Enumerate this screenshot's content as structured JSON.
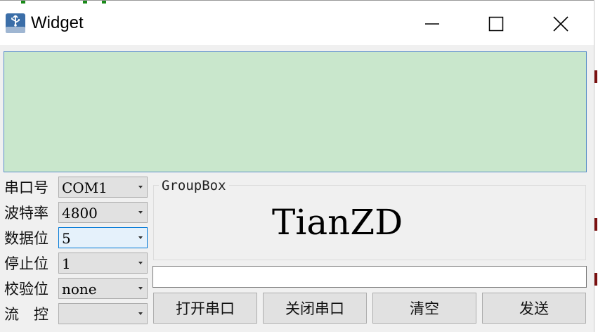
{
  "window": {
    "title": "Widget",
    "icon": "usb-icon",
    "controls": [
      "minimize-icon",
      "maximize-icon",
      "close-icon"
    ]
  },
  "receive_area": {
    "text": "",
    "background": "#c9e7cc"
  },
  "settings": [
    {
      "label": "串口号",
      "value": "COM1"
    },
    {
      "label": "波特率",
      "value": "4800"
    },
    {
      "label": "数据位",
      "value": "5"
    },
    {
      "label": "停止位",
      "value": "1"
    },
    {
      "label": "校验位",
      "value": "none"
    },
    {
      "label": "流　控",
      "value": ""
    }
  ],
  "groupbox": {
    "title": "GroupBox",
    "label": "TianZD"
  },
  "send_input": {
    "value": ""
  },
  "buttons": {
    "open": "打开串口",
    "close": "关闭串口",
    "clear": "清空",
    "send": "发送"
  }
}
